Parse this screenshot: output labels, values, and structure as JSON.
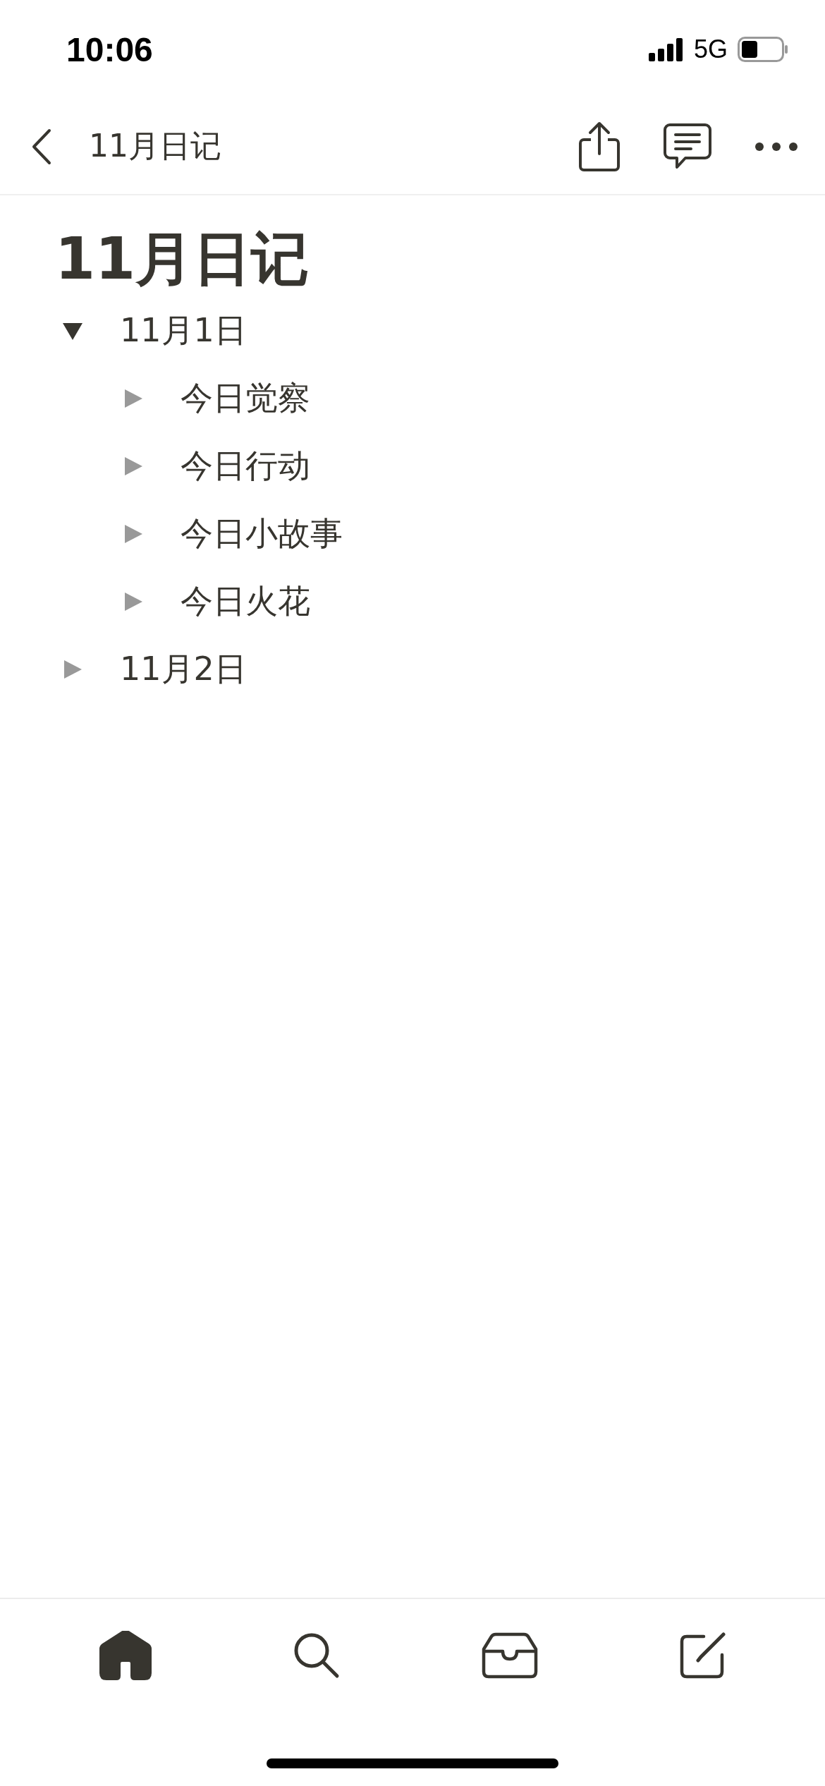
{
  "status_bar": {
    "time": "10:06",
    "network": "5G"
  },
  "nav_bar": {
    "title": "11月日记"
  },
  "page": {
    "title": "11月日记",
    "outline": [
      {
        "label": "11月1日",
        "expanded": true,
        "children": [
          {
            "label": "今日觉察",
            "expanded": false
          },
          {
            "label": "今日行动",
            "expanded": false
          },
          {
            "label": "今日小故事",
            "expanded": false
          },
          {
            "label": "今日火花",
            "expanded": false
          }
        ]
      },
      {
        "label": "11月2日",
        "expanded": false
      }
    ]
  },
  "tab_bar": [
    {
      "kind": "home",
      "selected": true
    },
    {
      "kind": "search",
      "selected": false
    },
    {
      "kind": "inbox",
      "selected": false
    },
    {
      "kind": "compose",
      "selected": false
    }
  ]
}
